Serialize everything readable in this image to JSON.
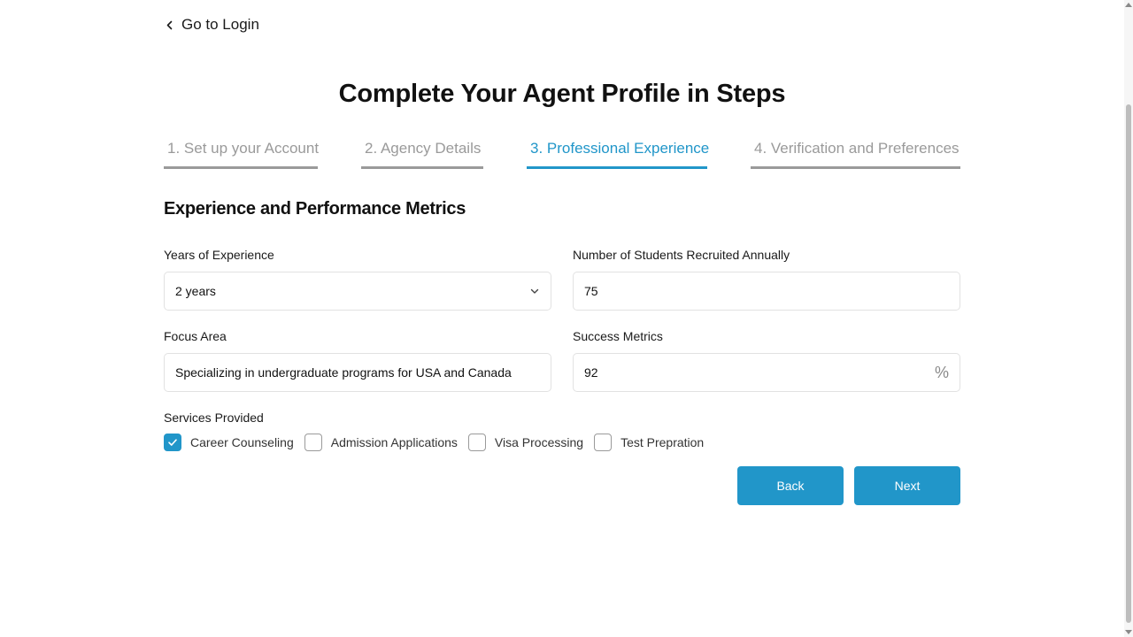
{
  "nav": {
    "back_label": "Go to Login"
  },
  "page": {
    "title": "Complete Your Agent Profile in Steps"
  },
  "steps": [
    {
      "label": "1. Set up your Account",
      "active": false
    },
    {
      "label": "2. Agency Details",
      "active": false
    },
    {
      "label": "3. Professional Experience",
      "active": true
    },
    {
      "label": "4. Verification and Preferences",
      "active": false
    }
  ],
  "section": {
    "title": "Experience and Performance Metrics"
  },
  "form": {
    "years_of_experience": {
      "label": "Years of Experience",
      "value": "2 years"
    },
    "students_recruited": {
      "label": "Number of Students Recruited Annually",
      "value": "75"
    },
    "focus_area": {
      "label": "Focus Area",
      "value": "Specializing in undergraduate programs for USA and Canada"
    },
    "success_metrics": {
      "label": "Success Metrics",
      "value": "92",
      "suffix": "%"
    },
    "services": {
      "label": "Services Provided",
      "options": [
        {
          "label": "Career Counseling",
          "checked": true
        },
        {
          "label": "Admission Applications",
          "checked": false
        },
        {
          "label": "Visa Processing",
          "checked": false
        },
        {
          "label": "Test Prepration",
          "checked": false
        }
      ]
    }
  },
  "buttons": {
    "back": "Back",
    "next": "Next"
  },
  "colors": {
    "accent": "#2196c9",
    "inactive_step": "#9a9a9a"
  },
  "icons": {
    "back": "chevron-left-icon",
    "dropdown": "chevron-down-icon",
    "check": "check-icon"
  }
}
